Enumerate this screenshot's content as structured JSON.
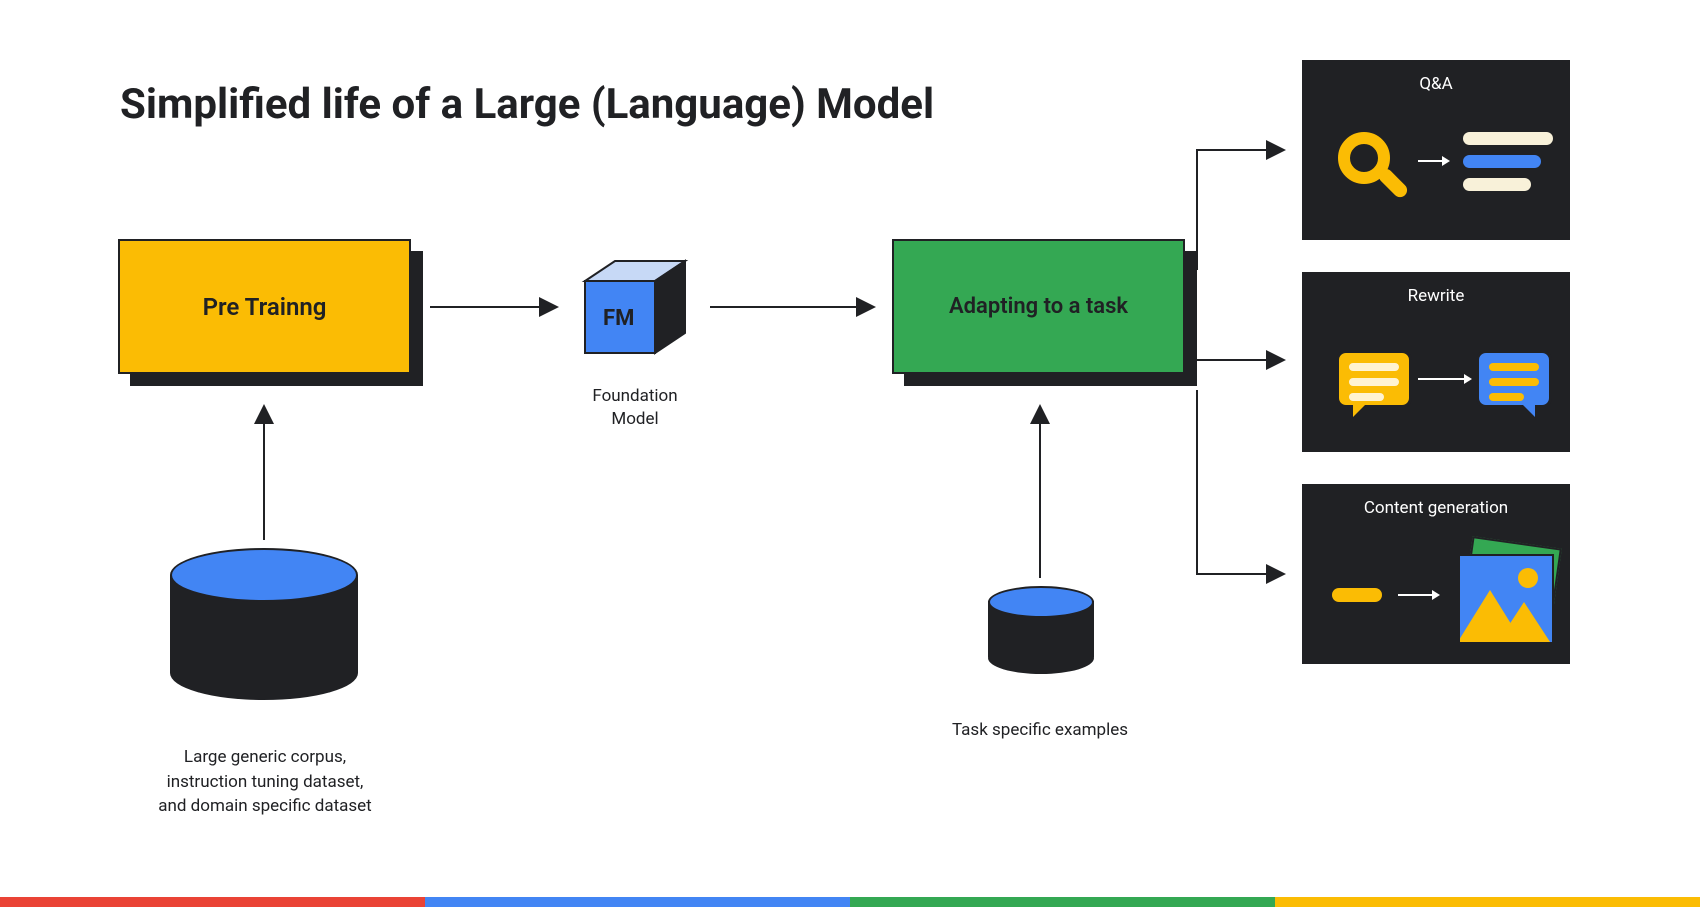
{
  "title": "Simplified life of a Large (Language) Model",
  "stage1": {
    "label": "Pre Trainng"
  },
  "fm": {
    "short": "FM",
    "caption": "Foundation\nModel"
  },
  "stage2": {
    "label": "Adapting to a task"
  },
  "corpus": {
    "caption": "Large generic corpus,\ninstruction tuning dataset,\nand domain specific dataset"
  },
  "task_examples": {
    "caption": "Task specific examples"
  },
  "outputs": {
    "qa": {
      "title": "Q&A"
    },
    "rewrite": {
      "title": "Rewrite"
    },
    "content": {
      "title": "Content generation"
    }
  },
  "colors": {
    "yellow": "#FBBC04",
    "blue": "#4285F4",
    "green": "#34A853",
    "red": "#EA4335",
    "dark": "#202124"
  }
}
